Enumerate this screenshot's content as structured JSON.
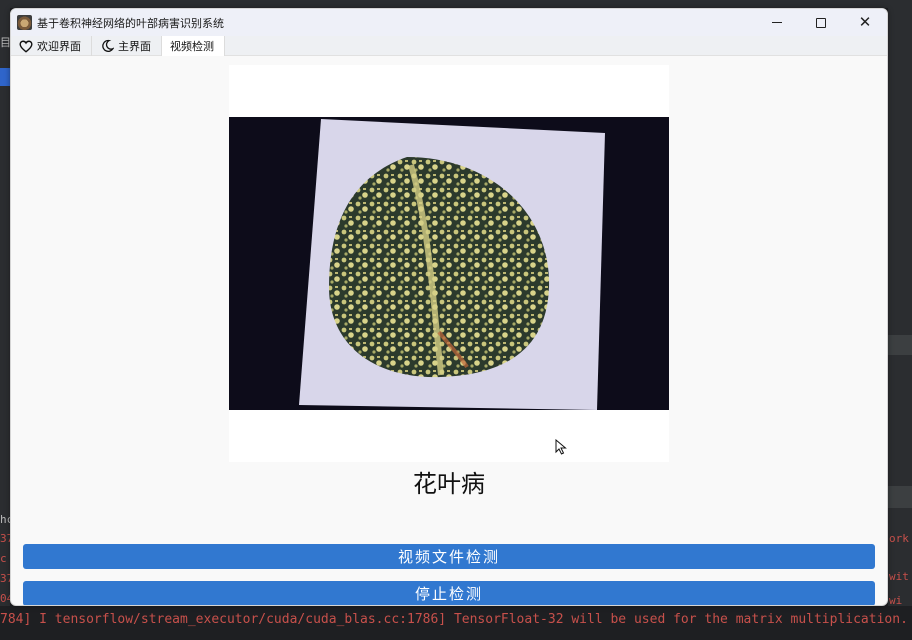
{
  "window": {
    "title": "基于卷积神经网络的叶部病害识别系统",
    "controls": {
      "close_glyph": "✕"
    }
  },
  "tabs": [
    {
      "label": "欢迎界面",
      "icon": "heart-icon",
      "active": false
    },
    {
      "label": "主界面",
      "icon": "moon-icon",
      "active": false
    },
    {
      "label": "视频检测",
      "icon": "",
      "active": true
    }
  ],
  "detection": {
    "result_label": "花叶病"
  },
  "buttons": {
    "video_file_detect": "视频文件检测",
    "stop_detect": "停止检测"
  },
  "background": {
    "console_line": "784] I tensorflow/stream_executor/cuda/cuda_blas.cc:1786] TensorFloat-32 will be used for the matrix multiplication. This will",
    "right_fragments": [
      "ork",
      "wit",
      "wi"
    ],
    "left_fragments": [
      "目",
      "hc",
      "37",
      "c",
      "37",
      "04"
    ]
  },
  "colors": {
    "accent_button": "#3178d0",
    "console_error": "#c7504b",
    "ide_highlight": "#2f65ca"
  }
}
